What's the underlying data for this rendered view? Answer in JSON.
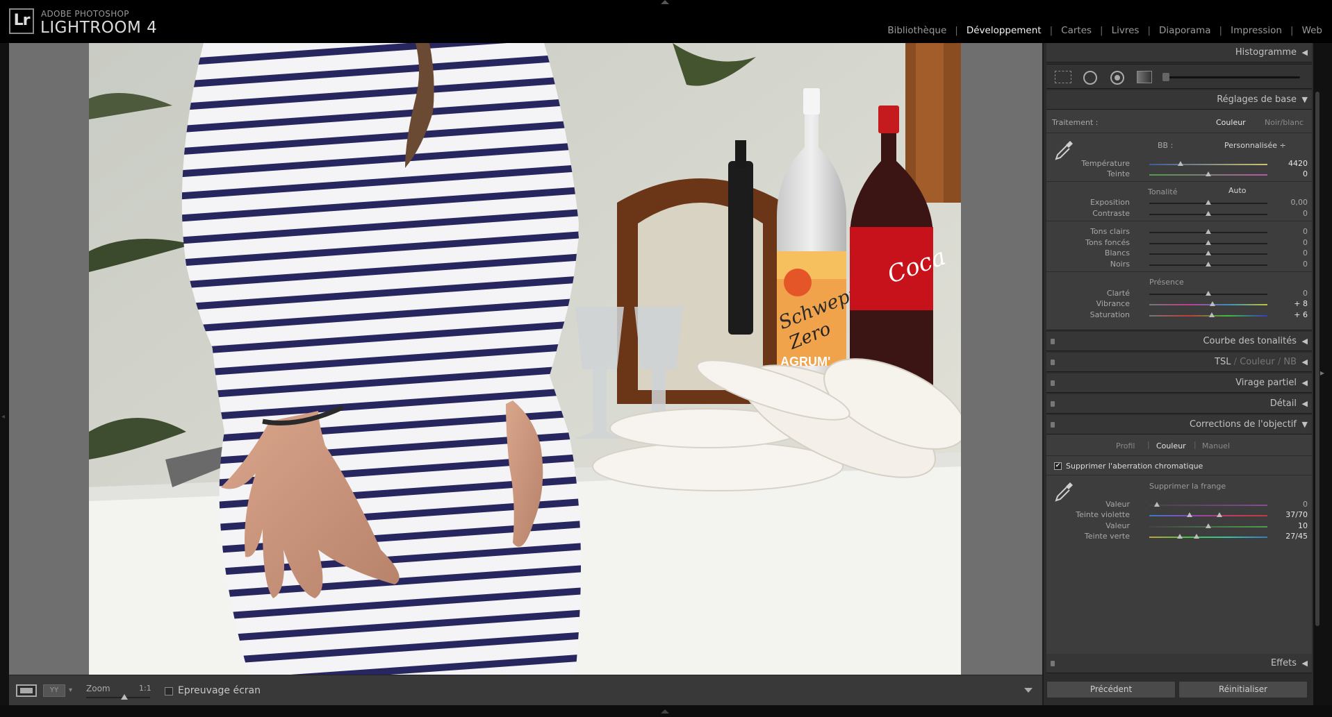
{
  "app": {
    "logo": "Lr",
    "subtitle": "ADOBE PHOTOSHOP",
    "title": "LIGHTROOM 4"
  },
  "modules": [
    {
      "label": "Bibliothèque",
      "active": false
    },
    {
      "label": "Développement",
      "active": true
    },
    {
      "label": "Cartes",
      "active": false
    },
    {
      "label": "Livres",
      "active": false
    },
    {
      "label": "Diaporama",
      "active": false
    },
    {
      "label": "Impression",
      "active": false
    },
    {
      "label": "Web",
      "active": false
    }
  ],
  "toolbar": {
    "zoom_label": "Zoom",
    "zoom_ratio": "1:1",
    "proof_label": "Epreuvage écran",
    "compare_icon_text": "YY"
  },
  "panels": {
    "histogram": "Histogramme",
    "basic": {
      "title": "Réglages de base",
      "treatment_label": "Traitement :",
      "treatment_color": "Couleur",
      "treatment_bw": "Noir/blanc",
      "wb_label": "BB :",
      "wb_value": "Personnalisée ÷",
      "temperature_label": "Température",
      "temperature_value": "4420",
      "tint_label": "Teinte",
      "tint_value": "0",
      "tone_label": "Tonalité",
      "auto_label": "Auto",
      "exposure_label": "Exposition",
      "exposure_value": "0,00",
      "contrast_label": "Contraste",
      "contrast_value": "0",
      "highlights_label": "Tons clairs",
      "highlights_value": "0",
      "shadows_label": "Tons foncés",
      "shadows_value": "0",
      "whites_label": "Blancs",
      "whites_value": "0",
      "blacks_label": "Noirs",
      "blacks_value": "0",
      "presence_label": "Présence",
      "clarity_label": "Clarté",
      "clarity_value": "0",
      "vibrance_label": "Vibrance",
      "vibrance_value": "+ 8",
      "saturation_label": "Saturation",
      "saturation_value": "+ 6"
    },
    "tone_curve": "Courbe des tonalités",
    "hsl": {
      "tsl": "TSL",
      "couleur": "Couleur",
      "nb": "NB",
      "sep": "/"
    },
    "split_toning": "Virage partiel",
    "detail": "Détail",
    "lens": {
      "title": "Corrections de l'objectif",
      "tab_profile": "Profil",
      "tab_color": "Couleur",
      "tab_manual": "Manuel",
      "remove_ca": "Supprimer l'aberration chromatique",
      "defringe": "Supprimer la frange",
      "purple_amount_label": "Valeur",
      "purple_amount_value": "0",
      "purple_hue_label": "Teinte violette",
      "purple_hue_value": "37/70",
      "green_amount_label": "Valeur",
      "green_amount_value": "10",
      "green_hue_label": "Teinte verte",
      "green_hue_value": "27/45"
    },
    "effects": "Effets"
  },
  "buttons": {
    "previous": "Précédent",
    "reset": "Réinitialiser"
  },
  "photo_text": {
    "schweppes": "Schweppes",
    "zero": "Zero",
    "agrumes": "AGRUM'",
    "coca": "Coca"
  },
  "colors": {
    "panel_bg": "#3d3d3d",
    "stripe": "#2b2a63",
    "coca_red": "#c8121b"
  }
}
